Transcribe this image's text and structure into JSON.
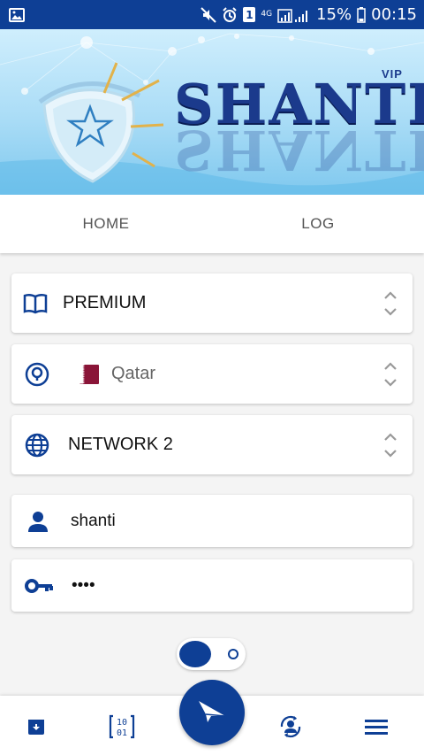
{
  "status_bar": {
    "battery": "15%",
    "time": "00:15",
    "network": "4G",
    "sim_badge": "1",
    "icons": [
      "image-icon",
      "mute-icon",
      "alarm-icon",
      "sim-icon",
      "signal-icon",
      "battery-icon"
    ]
  },
  "banner": {
    "brand": "SHANTI",
    "tag": "VIP"
  },
  "tabs": [
    {
      "label": "HOME"
    },
    {
      "label": "LOG"
    }
  ],
  "selectors": {
    "server_type": {
      "value": "PREMIUM",
      "icon": "book-icon"
    },
    "country": {
      "value": "Qatar",
      "icon": "location-pin-icon",
      "flag": "qatar-flag"
    },
    "network": {
      "value": "NETWORK 2",
      "icon": "globe-icon"
    }
  },
  "fields": {
    "username": {
      "value": "shanti",
      "icon": "person-icon"
    },
    "password": {
      "value": "••••",
      "icon": "key-icon"
    }
  },
  "toggle": {
    "state": "on"
  },
  "bottom_nav": {
    "items": [
      "archive-icon",
      "binary-icon",
      "send-icon",
      "account-sync-icon",
      "menu-icon"
    ]
  },
  "colors": {
    "primary": "#0e3f95",
    "background": "#f4f4f4",
    "flag_maroon": "#8a1538"
  }
}
